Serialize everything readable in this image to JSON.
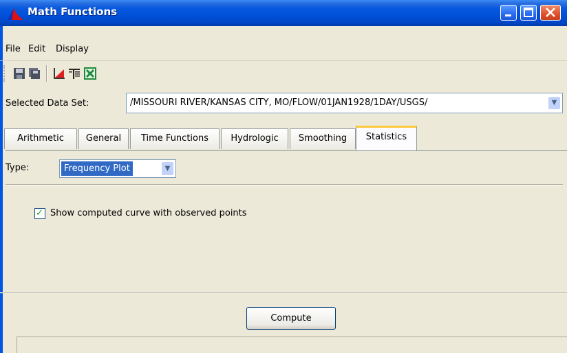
{
  "window": {
    "title": "Math Functions"
  },
  "menu": {
    "file": "File",
    "edit": "Edit",
    "display": "Display"
  },
  "dataset": {
    "label": "Selected Data Set:",
    "value": "/MISSOURI RIVER/KANSAS CITY, MO/FLOW/01JAN1928/1DAY/USGS/"
  },
  "tabs": [
    {
      "label": "Arithmetic"
    },
    {
      "label": "General"
    },
    {
      "label": "Time Functions"
    },
    {
      "label": "Hydrologic"
    },
    {
      "label": "Smoothing"
    },
    {
      "label": "Statistics"
    }
  ],
  "statistics": {
    "type_label": "Type:",
    "type_value": "Frequency Plot",
    "checkbox_label": "Show computed curve with observed points",
    "checkbox_checked": true
  },
  "actions": {
    "compute": "Compute"
  },
  "colors": {
    "title_bar": "#0050d8",
    "selected_item": "#316ac5",
    "active_tab_accent": "#ffc83c"
  },
  "icons": [
    "app-icon",
    "save-icon",
    "save-as-icon",
    "plot-icon",
    "table-icon",
    "excel-icon"
  ]
}
